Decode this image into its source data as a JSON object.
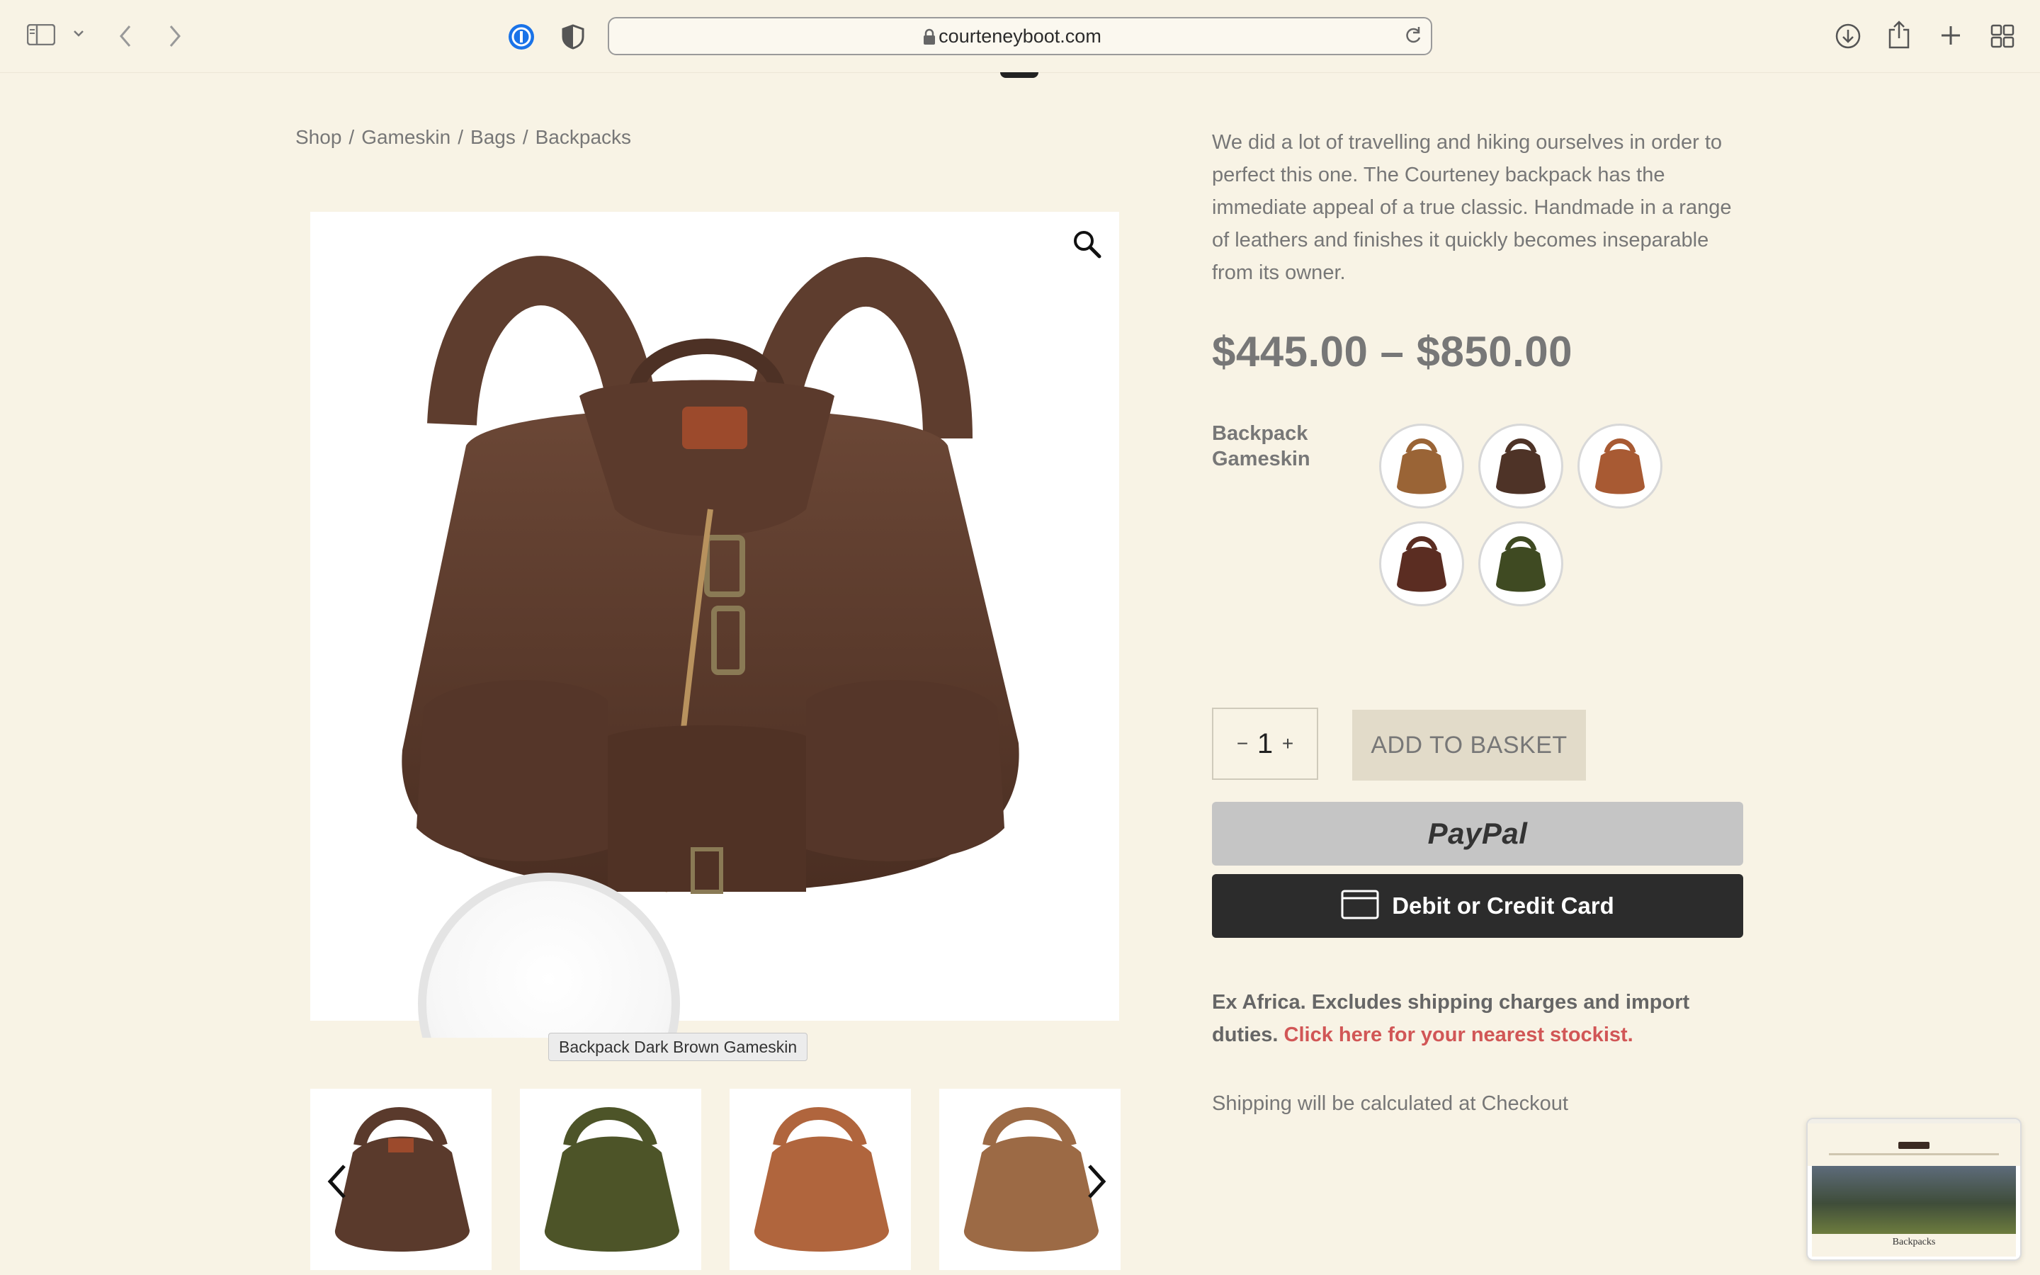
{
  "browser": {
    "url": "courteneyboot.com"
  },
  "breadcrumb": {
    "items": [
      "Shop",
      "Gameskin",
      "Bags",
      "Backpacks"
    ],
    "separator": "/"
  },
  "product": {
    "description": "We did a lot of travelling and hiking ourselves in order to perfect this one. The Courteney backpack has the immediate appeal of a true classic. Handmade in a range of leathers and finishes it quickly becomes inseparable from its owner.",
    "price": "$445.00 – $850.00",
    "variant_label": "Backpack Gameskin",
    "image_tooltip": "Backpack Dark Brown Gameskin",
    "swatches": [
      {
        "color": "#9a6436"
      },
      {
        "color": "#4e3327"
      },
      {
        "color": "#a85a33"
      },
      {
        "color": "#5b2d22"
      },
      {
        "color": "#3f4a22"
      }
    ],
    "thumbnails": [
      {
        "color": "#5a3a2c"
      },
      {
        "color": "#4d5428"
      },
      {
        "color": "#b0653d"
      },
      {
        "color": "#9c6a45"
      }
    ]
  },
  "purchase": {
    "qty_minus": "−",
    "qty_value": "1",
    "qty_plus": "+",
    "add_to_basket": "ADD TO BASKET",
    "paypal_label": "PayPal",
    "card_label": "Debit or Credit Card"
  },
  "notes": {
    "ex_africa": "Ex Africa. Excludes shipping charges and import duties.",
    "stockist_link": "Click here for your nearest stockist.",
    "shipping": "Shipping will be calculated at Checkout"
  },
  "preview": {
    "label": "Backpacks"
  },
  "colors": {
    "background": "#f8f3e5",
    "link": "#d15656",
    "card_button": "#2c2c2c",
    "paypal_button": "#c5c5c5",
    "basket_button": "#e2dbc9"
  }
}
